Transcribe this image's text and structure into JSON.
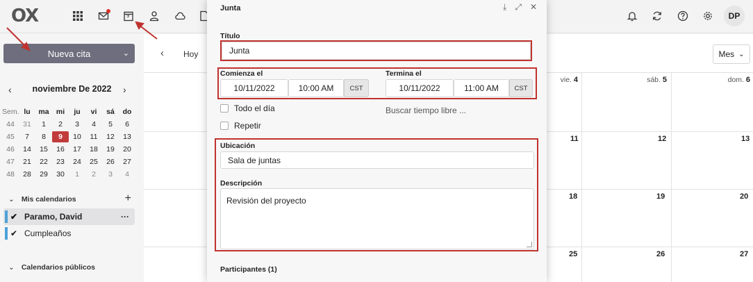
{
  "app": {
    "logo_text": "OX",
    "user_initials": "DP",
    "topbar_icons": [
      "apps-grid-icon",
      "mail-icon",
      "calendar-icon",
      "contacts-icon",
      "cloud-drive-icon",
      "documents-icon",
      "notifications-icon",
      "refresh-icon",
      "help-icon",
      "settings-icon"
    ],
    "calendar_icon_day": "9"
  },
  "sidebar": {
    "new_appointment_label": "Nueva cita",
    "month_title": "noviembre De 2022",
    "weekday_headers": [
      "Sem.",
      "lu",
      "ma",
      "mi",
      "ju",
      "vi",
      "sá",
      "do"
    ],
    "weeks": [
      [
        "44",
        "31",
        "1",
        "2",
        "3",
        "4",
        "5",
        "6"
      ],
      [
        "45",
        "7",
        "8",
        "9",
        "10",
        "11",
        "12",
        "13"
      ],
      [
        "46",
        "14",
        "15",
        "16",
        "17",
        "18",
        "19",
        "20"
      ],
      [
        "47",
        "21",
        "22",
        "23",
        "24",
        "25",
        "26",
        "27"
      ],
      [
        "48",
        "28",
        "29",
        "30",
        "1",
        "2",
        "3",
        "4"
      ]
    ],
    "today": "9",
    "my_calendars_label": "Mis calendarios",
    "calendars": [
      {
        "name": "Paramo, David",
        "selected": true
      },
      {
        "name": "Cumpleaños",
        "selected": false
      }
    ],
    "public_calendars_label": "Calendarios públicos",
    "calendar_color": "#4ea1d8",
    "today_color": "#c23b3b"
  },
  "main": {
    "today_label": "Hoy",
    "view_label": "Mes",
    "column_headers": [
      {
        "day": "vie.",
        "num": "4"
      },
      {
        "day": "sáb.",
        "num": "5"
      },
      {
        "day": "dom.",
        "num": "6"
      }
    ],
    "row_days": [
      [
        "11",
        "12",
        "13"
      ],
      [
        "18",
        "19",
        "20"
      ],
      [
        "25",
        "26",
        "27"
      ]
    ]
  },
  "modal": {
    "title": "Junta",
    "title_label": "Título",
    "title_value": "Junta",
    "starts_label": "Comienza el",
    "start_date": "10/11/2022",
    "start_time": "10:00 AM",
    "start_tz": "CST",
    "ends_label": "Termina el",
    "end_date": "10/11/2022",
    "end_time": "11:00 AM",
    "end_tz": "CST",
    "all_day_label": "Todo el día",
    "repeat_label": "Repetir",
    "find_free_time_label": "Buscar tiempo libre ...",
    "location_label": "Ubicación",
    "location_value": "Sala de juntas",
    "description_label": "Descripción",
    "description_value": "Revisión del proyecto",
    "participants_label": "Participantes (1)",
    "highlight_color": "#c0322f"
  }
}
